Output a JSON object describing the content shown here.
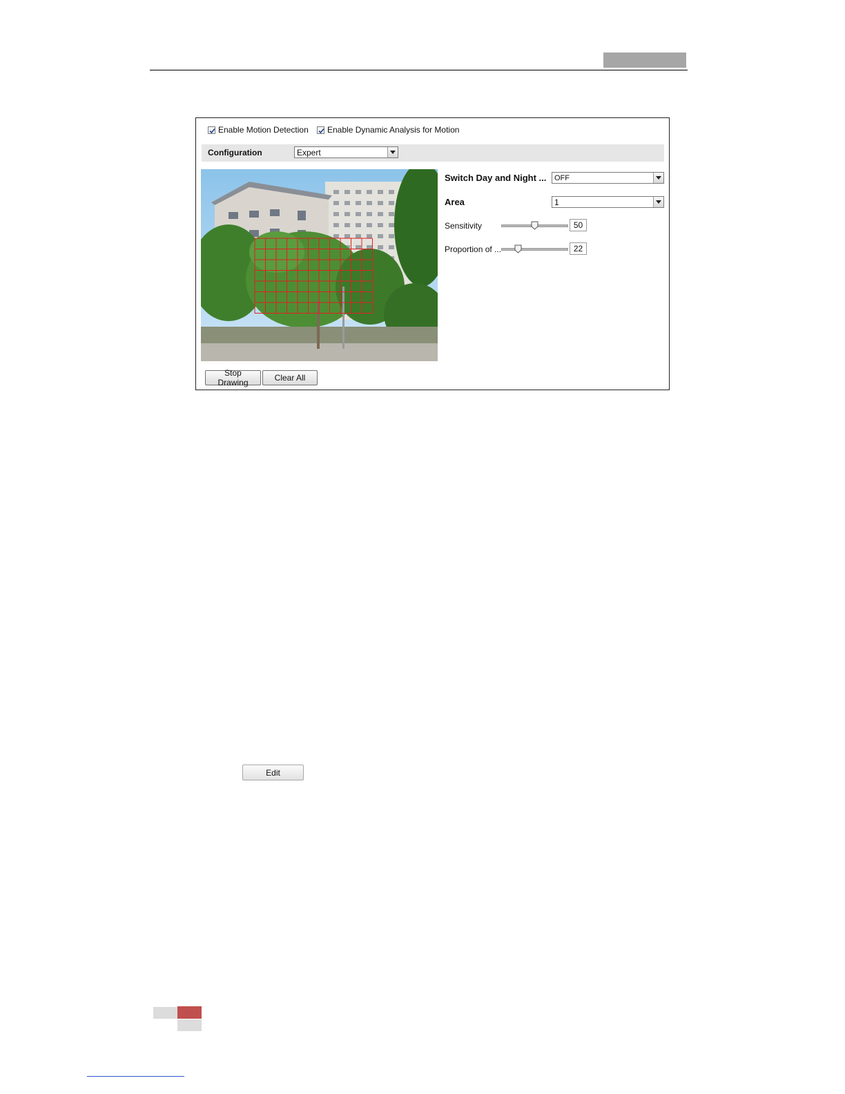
{
  "header": {
    "accent_color": "#a6a6a6"
  },
  "motion_panel": {
    "enable_motion_detection": {
      "label": "Enable Motion Detection",
      "checked": true
    },
    "enable_dynamic_analysis": {
      "label": "Enable Dynamic Analysis for Motion",
      "checked": true
    },
    "configuration": {
      "label": "Configuration",
      "value": "Expert"
    },
    "switch_day_night": {
      "label": "Switch Day and Night ...",
      "value": "OFF"
    },
    "area": {
      "label": "Area",
      "value": "1"
    },
    "sensitivity": {
      "label": "Sensitivity",
      "value": "50",
      "level": 0.5
    },
    "proportion": {
      "label": "Proportion of ...",
      "value": "22",
      "level": 0.22
    },
    "buttons": {
      "stop_drawing": "Stop Drawing",
      "clear_all": "Clear All"
    },
    "grid_color": "#e02020"
  },
  "edit_button": {
    "label": "Edit"
  },
  "footer": {
    "accent_color": "#c0504d",
    "neutral_color": "#dcdcdc"
  }
}
